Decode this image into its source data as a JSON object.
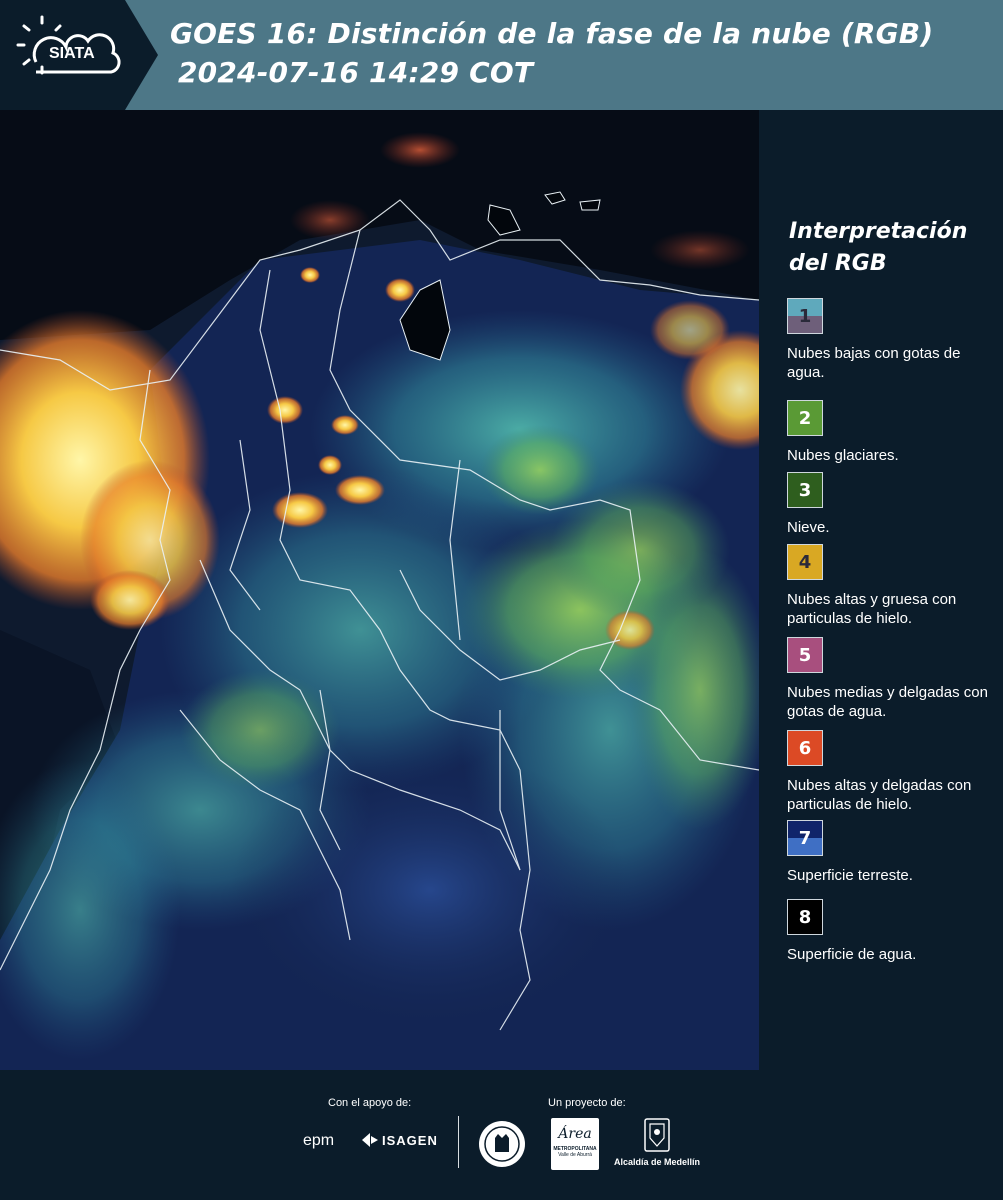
{
  "header": {
    "logo_text": "SIATA",
    "title_line1": "GOES 16: Distinción de la fase de la nube (RGB)",
    "title_line2": "2024-07-16 14:29 COT"
  },
  "legend": {
    "title": "Interpretación del RGB",
    "items": [
      {
        "num": "1",
        "label": "Nubes bajas con gotas de agua.",
        "top_color": "#5fa9bc",
        "bottom_color": "#6e5f7a"
      },
      {
        "num": "2",
        "label": "Nubes glaciares.",
        "top_color": "#5a9a35",
        "bottom_color": "#5a9a35"
      },
      {
        "num": "3",
        "label": "Nieve.",
        "top_color": "#2e5e1e",
        "bottom_color": "#2e5e1e"
      },
      {
        "num": "4",
        "label": "Nubes altas y gruesa con particulas de hielo.",
        "top_color": "#d9a823",
        "bottom_color": "#d9a823"
      },
      {
        "num": "5",
        "label": "Nubes medias y delgadas con gotas de agua.",
        "top_color": "#a84f7e",
        "bottom_color": "#a84f7e"
      },
      {
        "num": "6",
        "label": "Nubes altas y delgadas con particulas de hielo.",
        "top_color": "#dc4a25",
        "bottom_color": "#dc4a25"
      },
      {
        "num": "7",
        "label": "Superficie terreste.",
        "top_color": "#10246a",
        "bottom_color": "#3f6fc4"
      },
      {
        "num": "8",
        "label": "Superficie de agua.",
        "top_color": "#000000",
        "bottom_color": "#000000"
      }
    ]
  },
  "footer": {
    "support_label": "Con el apoyo de:",
    "project_label": "Un proyecto de:",
    "sponsor_1": "epm",
    "sponsor_2": "ISAGEN",
    "partner_area_1": "Área",
    "partner_area_2": "METROPOLITANA",
    "partner_area_3": "Valle de Aburrá",
    "partner_medellin": "Alcaldía de Medellín"
  }
}
